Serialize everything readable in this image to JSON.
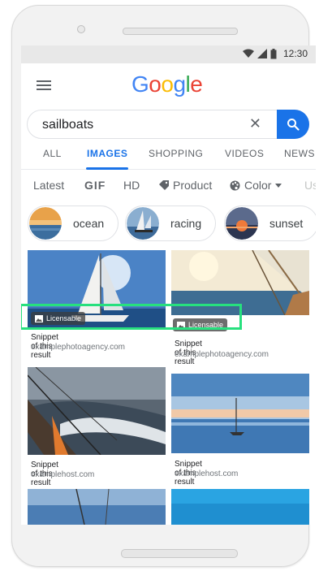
{
  "status": {
    "time": "12:30"
  },
  "header": {
    "logo_letters": [
      "G",
      "o",
      "o",
      "g",
      "l",
      "e"
    ],
    "logo_colors": [
      "#4285f4",
      "#ea4335",
      "#fbbc05",
      "#4285f4",
      "#34a853",
      "#ea4335"
    ]
  },
  "search": {
    "query": "sailboats",
    "clear_symbol": "✕"
  },
  "tabs": [
    "ALL",
    "IMAGES",
    "SHOPPING",
    "VIDEOS",
    "NEWS"
  ],
  "active_tab": "IMAGES",
  "filters": {
    "latest": "Latest",
    "gif": "GIF",
    "hd": "HD",
    "product": "Product",
    "color": "Color",
    "more": "Us"
  },
  "chips": [
    "ocean",
    "racing",
    "sunset"
  ],
  "results": [
    {
      "snippet": "Snippet of this result",
      "source": "examplephotoagency.com",
      "badge": "Licensable"
    },
    {
      "snippet": "Snippet of this result",
      "source": "examplephotoagency.com",
      "badge": "Licensable"
    },
    {
      "snippet": "Snippet of this result",
      "source": "examplehost.com"
    },
    {
      "snippet": "Snippet of this result",
      "source": "examplehost.com"
    }
  ],
  "colors": {
    "accent": "#1a73e8",
    "highlight": "#27e07e"
  }
}
